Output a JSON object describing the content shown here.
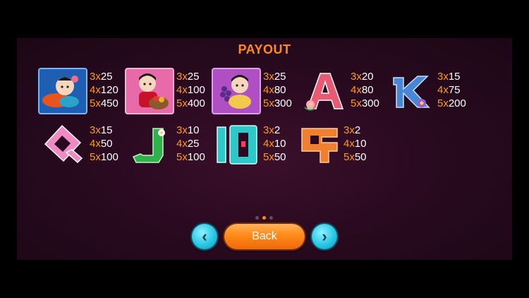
{
  "title": "PAYOUT",
  "symbols": [
    {
      "icon": "boy-koi-fish-icon",
      "pays": [
        {
          "k": "3x",
          "v": "25"
        },
        {
          "k": "4x",
          "v": "120"
        },
        {
          "k": "5x",
          "v": "450"
        }
      ]
    },
    {
      "icon": "girl-fruit-basket-icon",
      "pays": [
        {
          "k": "3x",
          "v": "25"
        },
        {
          "k": "4x",
          "v": "100"
        },
        {
          "k": "5x",
          "v": "400"
        }
      ]
    },
    {
      "icon": "child-grapes-icon",
      "pays": [
        {
          "k": "3x",
          "v": "25"
        },
        {
          "k": "4x",
          "v": "80"
        },
        {
          "k": "5x",
          "v": "300"
        }
      ]
    },
    {
      "icon": "letter-a-icon",
      "pays": [
        {
          "k": "3x",
          "v": "20"
        },
        {
          "k": "4x",
          "v": "80"
        },
        {
          "k": "5x",
          "v": "300"
        }
      ]
    },
    {
      "icon": "letter-k-icon",
      "pays": [
        {
          "k": "3x",
          "v": "15"
        },
        {
          "k": "4x",
          "v": "75"
        },
        {
          "k": "5x",
          "v": "200"
        }
      ]
    },
    {
      "icon": "letter-q-icon",
      "pays": [
        {
          "k": "3x",
          "v": "15"
        },
        {
          "k": "4x",
          "v": "50"
        },
        {
          "k": "5x",
          "v": "100"
        }
      ]
    },
    {
      "icon": "letter-j-icon",
      "pays": [
        {
          "k": "3x",
          "v": "10"
        },
        {
          "k": "4x",
          "v": "25"
        },
        {
          "k": "5x",
          "v": "100"
        }
      ]
    },
    {
      "icon": "number-10-icon",
      "pays": [
        {
          "k": "3x",
          "v": "2"
        },
        {
          "k": "4x",
          "v": "10"
        },
        {
          "k": "5x",
          "v": "50"
        }
      ]
    },
    {
      "icon": "number-9-icon",
      "pays": [
        {
          "k": "3x",
          "v": "2"
        },
        {
          "k": "4x",
          "v": "10"
        },
        {
          "k": "5x",
          "v": "50"
        }
      ]
    }
  ],
  "pager": {
    "pages": 3,
    "current": 2
  },
  "buttons": {
    "back_label": "Back",
    "prev_icon": "chevron-left-icon",
    "next_icon": "chevron-right-icon"
  },
  "colors": {
    "accent": "#ff8a14",
    "button_cyan": "#29c6e6",
    "button_orange": "#ff8a1a"
  }
}
